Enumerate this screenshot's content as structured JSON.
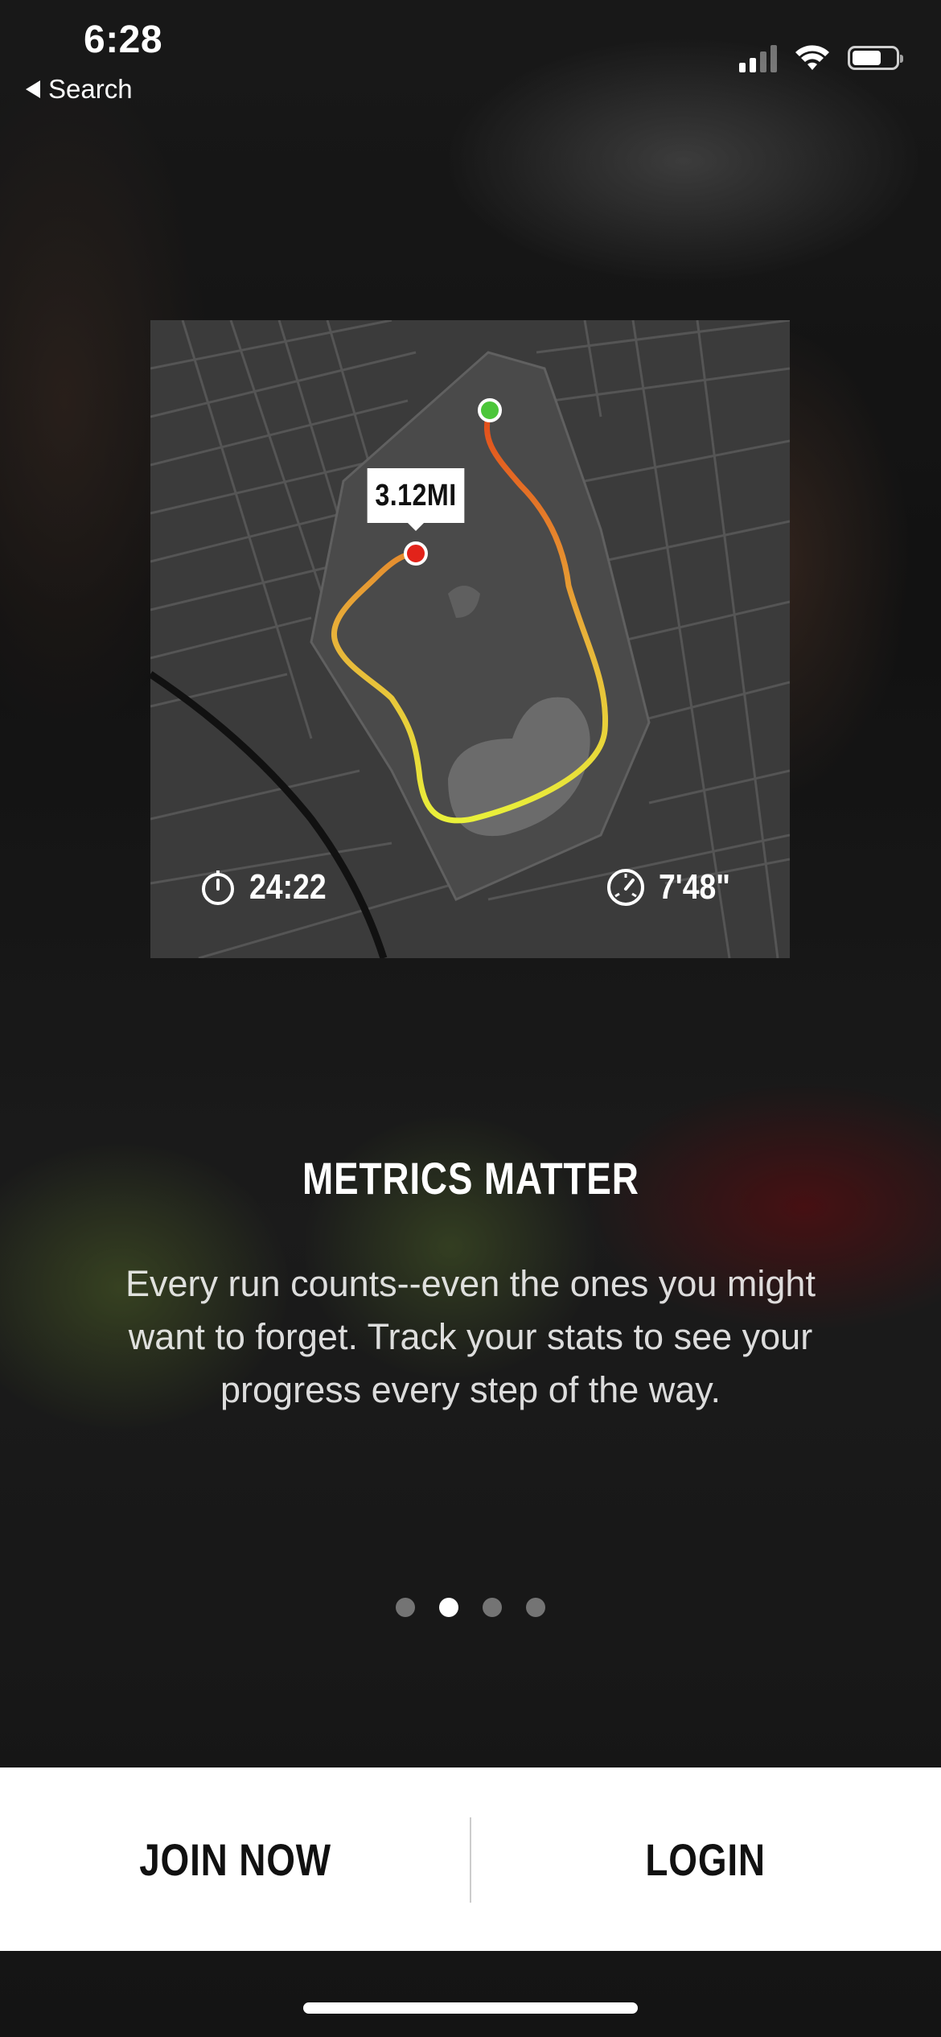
{
  "status_bar": {
    "time": "6:28",
    "back_label": "Search"
  },
  "map_card": {
    "distance_label": "3.12MI",
    "duration": "24:22",
    "pace": "7'48\"",
    "route_colors": {
      "start": "#4CC63A",
      "end": "#E2231A",
      "gradient_from": "#E24A1A",
      "gradient_to": "#E9F03A"
    }
  },
  "onboarding": {
    "headline": "METRICS MATTER",
    "body": "Every run counts--even the ones you might want to forget. Track your stats to see your progress every step of the way.",
    "page_count": 4,
    "active_page": 2
  },
  "actions": {
    "join_label": "JOIN NOW",
    "login_label": "LOGIN"
  }
}
